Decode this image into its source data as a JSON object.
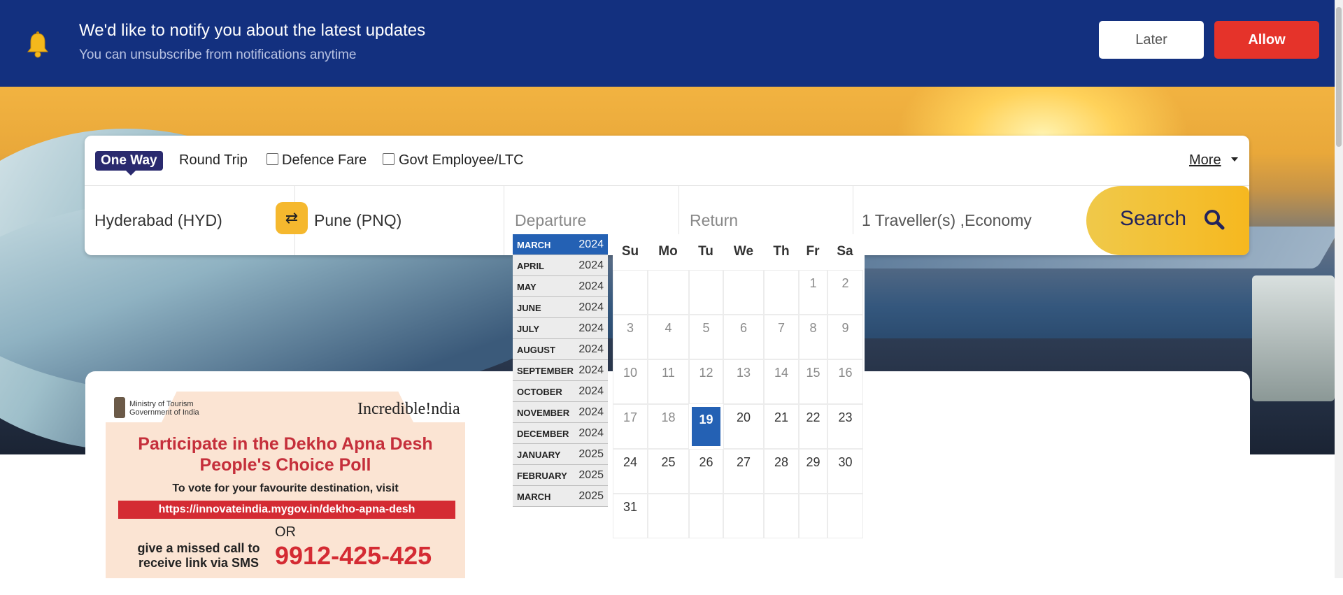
{
  "notification": {
    "title": "We'd like to notify you about the latest updates",
    "subtitle": "You can unsubscribe from notifications anytime",
    "later_label": "Later",
    "allow_label": "Allow",
    "icon": "bell-icon"
  },
  "search_form": {
    "trip_types": {
      "one_way": "One Way",
      "round_trip": "Round Trip",
      "defence_fare": "Defence Fare",
      "govt_employee": "Govt Employee/LTC"
    },
    "more_label": "More",
    "from": "Hyderabad (HYD)",
    "to": "Pune (PNQ)",
    "departure_placeholder": "Departure",
    "return_placeholder": "Return",
    "travellers": "1 Traveller(s) ,Economy",
    "search_label": "Search"
  },
  "datepicker": {
    "months": [
      {
        "name": "MARCH",
        "year": "2024",
        "active": true
      },
      {
        "name": "APRIL",
        "year": "2024"
      },
      {
        "name": "MAY",
        "year": "2024"
      },
      {
        "name": "JUNE",
        "year": "2024"
      },
      {
        "name": "JULY",
        "year": "2024"
      },
      {
        "name": "AUGUST",
        "year": "2024"
      },
      {
        "name": "SEPTEMBER",
        "year": "2024"
      },
      {
        "name": "OCTOBER",
        "year": "2024"
      },
      {
        "name": "NOVEMBER",
        "year": "2024"
      },
      {
        "name": "DECEMBER",
        "year": "2024"
      },
      {
        "name": "JANUARY",
        "year": "2025"
      },
      {
        "name": "FEBRUARY",
        "year": "2025"
      },
      {
        "name": "MARCH",
        "year": "2025"
      }
    ],
    "weekdays": [
      "Su",
      "Mo",
      "Tu",
      "We",
      "Th",
      "Fr",
      "Sa"
    ],
    "weeks": [
      [
        "",
        "",
        "",
        "",
        "",
        "1",
        "2"
      ],
      [
        "3",
        "4",
        "5",
        "6",
        "7",
        "8",
        "9"
      ],
      [
        "10",
        "11",
        "12",
        "13",
        "14",
        "15",
        "16"
      ],
      [
        "17",
        "18",
        "19",
        "20",
        "21",
        "22",
        "23"
      ],
      [
        "24",
        "25",
        "26",
        "27",
        "28",
        "29",
        "30"
      ],
      [
        "31",
        "",
        "",
        "",
        "",
        "",
        ""
      ]
    ],
    "selected_day": "19"
  },
  "banner": {
    "ministry": "Ministry of Tourism Government of India",
    "brand": "Incredible!ndia",
    "headline": "Participate in the Dekho Apna Desh People's Choice Poll",
    "vote_text": "To vote for your favourite destination, visit",
    "url": "https://innovateindia.mygov.in/dekho-apna-desh",
    "or_text": "OR",
    "call_text": "give a missed call to receive link via SMS",
    "phone": "9912-425-425"
  },
  "colors": {
    "notify_bg": "#13307f",
    "allow_bg": "#e5332a",
    "accent_blue": "#2461b4",
    "search_yellow": "#f6b81f",
    "pill_bg": "#2a2a6e"
  }
}
